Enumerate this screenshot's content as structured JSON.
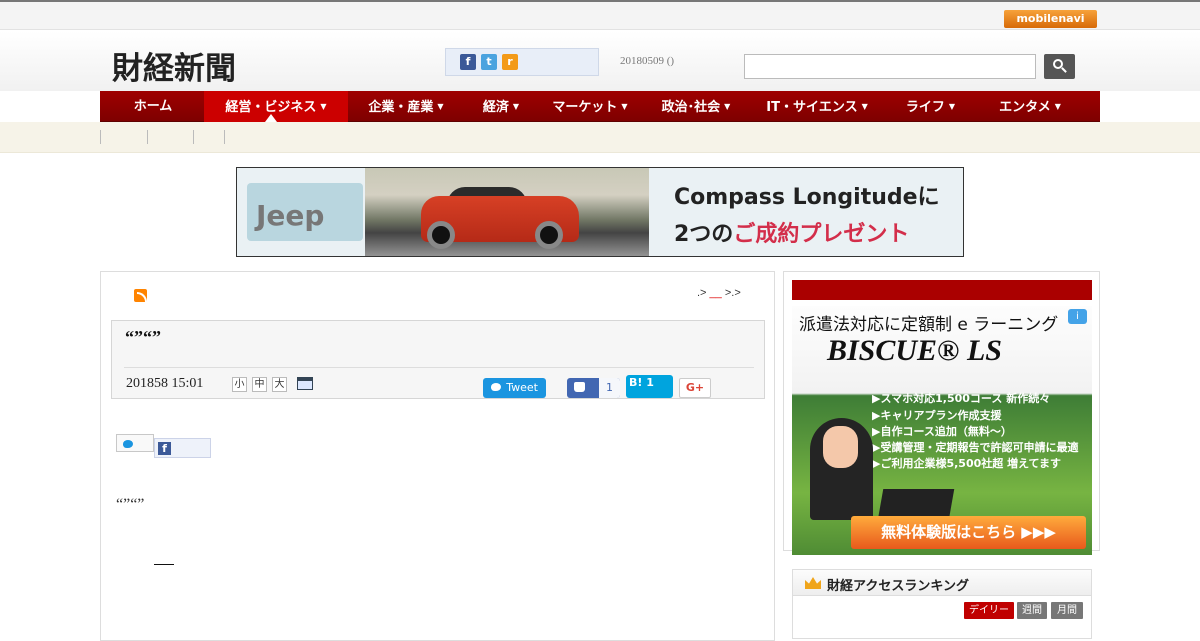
{
  "topbar": {
    "mobile_logo": "mobilenavi"
  },
  "header": {
    "site_title": "財経新聞",
    "date_text": "20180509 ()",
    "search": {
      "placeholder": "",
      "value": ""
    },
    "social_icons": [
      "facebook-icon",
      "twitter-icon",
      "rss-icon"
    ]
  },
  "nav": {
    "items": [
      {
        "label": "ホーム",
        "has_dropdown": false,
        "active": false
      },
      {
        "label": "経営・ビジネス",
        "has_dropdown": true,
        "active": true
      },
      {
        "label": "企業・産業",
        "has_dropdown": true,
        "active": false
      },
      {
        "label": "経済",
        "has_dropdown": true,
        "active": false
      },
      {
        "label": "マーケット",
        "has_dropdown": true,
        "active": false
      },
      {
        "label": "政治･社会",
        "has_dropdown": true,
        "active": false
      },
      {
        "label": "IT・サイエンス",
        "has_dropdown": true,
        "active": false
      },
      {
        "label": "ライフ",
        "has_dropdown": true,
        "active": false
      },
      {
        "label": "エンタメ",
        "has_dropdown": true,
        "active": false
      }
    ],
    "caret": "▼",
    "accent_color": "#a00000"
  },
  "banner": {
    "brand": "Jeep",
    "line1": "Compass Longitudeに",
    "line2_prefix": "2つの",
    "line2_highlight": "ご成約プレゼント"
  },
  "article": {
    "breadcrumb": {
      "part1": ".>",
      "part2": "__",
      "part3": ">.>"
    },
    "title": "“”“”",
    "date": "201858 15:01",
    "font_sizes": [
      "小",
      "中",
      "大"
    ],
    "share": {
      "tweet": "Tweet",
      "like_count": "1",
      "hatena_label": "B!",
      "hatena_count": "1",
      "gplus": "G+"
    },
    "body_quotes": "“”“”"
  },
  "sidebar": {
    "ad": {
      "headline": "派遣法対応に定額制 e ラーニング",
      "brand": "BISCUE® LS",
      "bullets": [
        "▶スマホ対応1,500コース 新作続々",
        "▶キャリアプラン作成支援",
        "▶自作コース追加（無料〜）",
        "▶受講管理・定期報告で許認可申請に最適",
        "▶ご利用企業様5,500社超 増えてます"
      ],
      "cta": "無料体験版はこちら ▶▶▶",
      "info_icon": "i"
    },
    "ranking": {
      "title": "財経アクセスランキング",
      "tabs": [
        {
          "label": "デイリー",
          "color": "#c00000"
        },
        {
          "label": "週間",
          "color": "#777777"
        },
        {
          "label": "月間",
          "color": "#777777"
        }
      ]
    }
  }
}
